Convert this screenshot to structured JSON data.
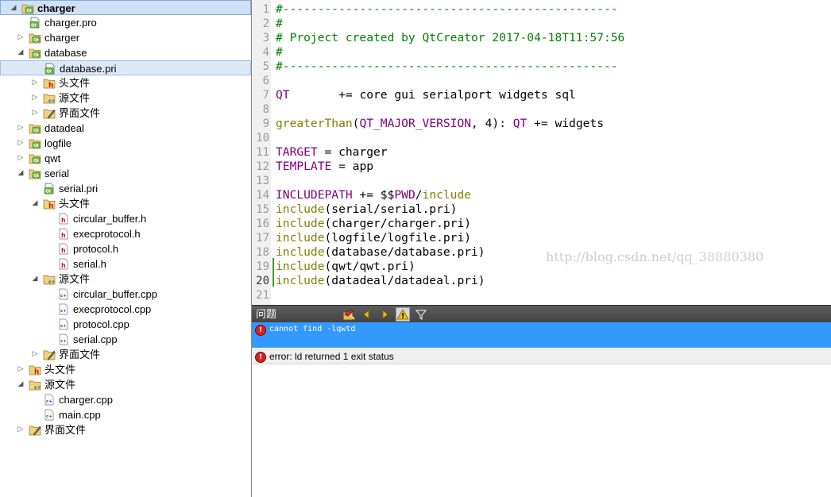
{
  "project_tree": {
    "items": [
      {
        "label": "charger",
        "icon": "qt-project-icon",
        "arrow": "expanded",
        "level": 0
      },
      {
        "label": "charger.pro",
        "icon": "pro-file-icon",
        "arrow": "",
        "level": 1
      },
      {
        "label": "charger",
        "icon": "qt-folder-icon",
        "arrow": "collapsed",
        "level": 1
      },
      {
        "label": "database",
        "icon": "qt-folder-icon",
        "arrow": "expanded",
        "level": 1
      },
      {
        "label": "database.pri",
        "icon": "pri-file-icon",
        "arrow": "",
        "level": 2
      },
      {
        "label": "头文件",
        "icon": "headers-folder-icon",
        "arrow": "collapsed",
        "level": 2
      },
      {
        "label": "源文件",
        "icon": "sources-folder-icon",
        "arrow": "collapsed",
        "level": 2
      },
      {
        "label": "界面文件",
        "icon": "forms-folder-icon",
        "arrow": "collapsed",
        "level": 2
      },
      {
        "label": "datadeal",
        "icon": "qt-folder-icon",
        "arrow": "collapsed",
        "level": 1
      },
      {
        "label": "logfile",
        "icon": "qt-folder-icon",
        "arrow": "collapsed",
        "level": 1
      },
      {
        "label": "qwt",
        "icon": "qt-folder-icon",
        "arrow": "collapsed",
        "level": 1
      },
      {
        "label": "serial",
        "icon": "qt-folder-icon",
        "arrow": "expanded",
        "level": 1
      },
      {
        "label": "serial.pri",
        "icon": "pri-file-icon",
        "arrow": "",
        "level": 2
      },
      {
        "label": "头文件",
        "icon": "headers-folder-icon",
        "arrow": "expanded",
        "level": 2
      },
      {
        "label": "circular_buffer.h",
        "icon": "header-file-icon",
        "arrow": "",
        "level": 3
      },
      {
        "label": "execprotocol.h",
        "icon": "header-file-icon",
        "arrow": "",
        "level": 3
      },
      {
        "label": "protocol.h",
        "icon": "header-file-icon",
        "arrow": "",
        "level": 3
      },
      {
        "label": "serial.h",
        "icon": "header-file-icon",
        "arrow": "",
        "level": 3
      },
      {
        "label": "源文件",
        "icon": "sources-folder-icon",
        "arrow": "expanded",
        "level": 2
      },
      {
        "label": "circular_buffer.cpp",
        "icon": "cpp-file-icon",
        "arrow": "",
        "level": 3
      },
      {
        "label": "execprotocol.cpp",
        "icon": "cpp-file-icon",
        "arrow": "",
        "level": 3
      },
      {
        "label": "protocol.cpp",
        "icon": "cpp-file-icon",
        "arrow": "",
        "level": 3
      },
      {
        "label": "serial.cpp",
        "icon": "cpp-file-icon",
        "arrow": "",
        "level": 3
      },
      {
        "label": "界面文件",
        "icon": "forms-folder-icon",
        "arrow": "collapsed",
        "level": 2
      },
      {
        "label": "头文件",
        "icon": "headers-folder-icon",
        "arrow": "collapsed",
        "level": 1
      },
      {
        "label": "源文件",
        "icon": "sources-folder-icon",
        "arrow": "expanded",
        "level": 1
      },
      {
        "label": "charger.cpp",
        "icon": "cpp-file-icon",
        "arrow": "",
        "level": 2
      },
      {
        "label": "main.cpp",
        "icon": "cpp-file-icon",
        "arrow": "",
        "level": 2
      },
      {
        "label": "界面文件",
        "icon": "forms-folder-icon",
        "arrow": "collapsed",
        "level": 1
      }
    ],
    "selected_index": 4
  },
  "editor": {
    "current_line": 20,
    "lines": [
      {
        "n": "1",
        "segs": [
          [
            "#------------------------------------------------",
            "comment"
          ]
        ]
      },
      {
        "n": "2",
        "segs": [
          [
            "#",
            "comment"
          ]
        ]
      },
      {
        "n": "3",
        "segs": [
          [
            "# Project created by QtCreator 2017-04-18T11:57:56",
            "comment"
          ]
        ]
      },
      {
        "n": "4",
        "segs": [
          [
            "#",
            "comment"
          ]
        ]
      },
      {
        "n": "5",
        "segs": [
          [
            "#------------------------------------------------",
            "comment"
          ]
        ]
      },
      {
        "n": "6",
        "segs": []
      },
      {
        "n": "7",
        "segs": [
          [
            "QT",
            "var"
          ],
          [
            "       += core gui serialport widgets sql",
            "plain"
          ]
        ]
      },
      {
        "n": "8",
        "segs": []
      },
      {
        "n": "9",
        "segs": [
          [
            "greaterThan",
            "func"
          ],
          [
            "(",
            "plain"
          ],
          [
            "QT_MAJOR_VERSION",
            "var"
          ],
          [
            ", 4): ",
            "plain"
          ],
          [
            "QT",
            "var"
          ],
          [
            " += widgets",
            "plain"
          ]
        ]
      },
      {
        "n": "10",
        "segs": []
      },
      {
        "n": "11",
        "segs": [
          [
            "TARGET",
            "var"
          ],
          [
            " = charger",
            "plain"
          ]
        ]
      },
      {
        "n": "12",
        "segs": [
          [
            "TEMPLATE",
            "var"
          ],
          [
            " = app",
            "plain"
          ]
        ]
      },
      {
        "n": "13",
        "segs": []
      },
      {
        "n": "14",
        "segs": [
          [
            "INCLUDEPATH",
            "var"
          ],
          [
            " += $$",
            "plain"
          ],
          [
            "PWD",
            "var"
          ],
          [
            "/",
            "plain"
          ],
          [
            "include",
            "func"
          ]
        ]
      },
      {
        "n": "15",
        "segs": [
          [
            "include",
            "func"
          ],
          [
            "(serial/serial.pri)",
            "plain"
          ]
        ]
      },
      {
        "n": "16",
        "segs": [
          [
            "include",
            "func"
          ],
          [
            "(charger/charger.pri)",
            "plain"
          ]
        ]
      },
      {
        "n": "17",
        "segs": [
          [
            "include",
            "func"
          ],
          [
            "(logfile/logfile.pri)",
            "plain"
          ]
        ]
      },
      {
        "n": "18",
        "segs": [
          [
            "include",
            "func"
          ],
          [
            "(database/database.pri)",
            "plain"
          ]
        ]
      },
      {
        "n": "19",
        "segs": [
          [
            "include",
            "func"
          ],
          [
            "(qwt/qwt.pri)",
            "plain"
          ]
        ]
      },
      {
        "n": "20",
        "segs": [
          [
            "include",
            "func"
          ],
          [
            "(datadeal/datadeal.pri)",
            "plain"
          ]
        ]
      },
      {
        "n": "21",
        "segs": []
      }
    ],
    "watermark": "http://blog.csdn.net/qq_38880380"
  },
  "issues_panel": {
    "title": "问题",
    "toolbar": [
      "build-icon",
      "previous-icon",
      "next-icon",
      "warning-filter-icon",
      "filter-icon"
    ],
    "items": [
      {
        "text": "cannot find -lqwtd",
        "selected": true
      },
      {
        "text": "error: ld returned 1 exit status",
        "selected": false
      }
    ]
  },
  "colors": {
    "comment": "#008000",
    "var": "#800080",
    "func": "#808000",
    "plain": "#000000",
    "selection": "#3399ff"
  }
}
